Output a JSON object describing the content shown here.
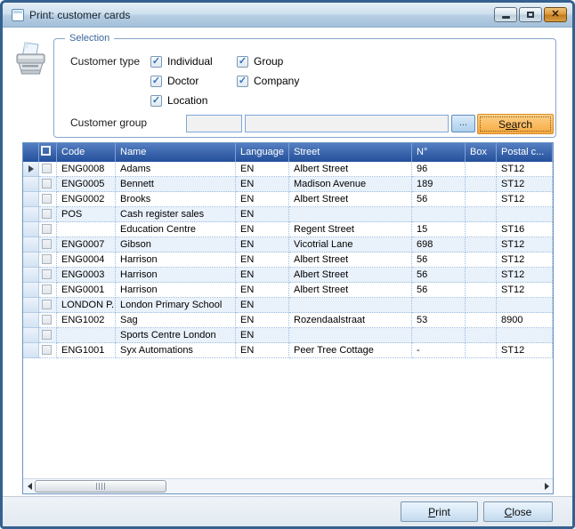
{
  "window": {
    "title": "Print: customer cards",
    "close_glyph": "✕"
  },
  "selection": {
    "group_label": "Selection",
    "customer_type_label": "Customer type",
    "customer_types": [
      {
        "label": "Individual",
        "checked": true
      },
      {
        "label": "Group",
        "checked": true
      },
      {
        "label": "Doctor",
        "checked": true
      },
      {
        "label": "Company",
        "checked": true
      },
      {
        "label": "Location",
        "checked": true
      }
    ],
    "customer_group_label": "Customer group",
    "group_code_value": "",
    "group_name_value": "",
    "browse_label": "...",
    "search_label": {
      "pre": "S",
      "key": "ea",
      "post": "rch"
    }
  },
  "grid": {
    "columns": [
      "Code",
      "Name",
      "Language",
      "Street",
      "N°",
      "Box",
      "Postal c..."
    ],
    "fields": [
      "code",
      "name",
      "language",
      "street",
      "no",
      "box",
      "postal"
    ],
    "rows": [
      {
        "code": "ENG0008",
        "name": "Adams",
        "language": "EN",
        "street": "Albert Street",
        "no": "96",
        "box": "",
        "postal": "ST12",
        "current": true,
        "checked": false
      },
      {
        "code": "ENG0005",
        "name": "Bennett",
        "language": "EN",
        "street": "Madison Avenue",
        "no": "189",
        "box": "",
        "postal": "ST12",
        "current": false,
        "checked": false
      },
      {
        "code": "ENG0002",
        "name": "Brooks",
        "language": "EN",
        "street": "Albert Street",
        "no": "56",
        "box": "",
        "postal": "ST12",
        "current": false,
        "checked": false
      },
      {
        "code": "POS",
        "name": "Cash register sales",
        "language": "EN",
        "street": "",
        "no": "",
        "box": "",
        "postal": "",
        "current": false,
        "checked": false
      },
      {
        "code": "",
        "name": "Education Centre",
        "language": "EN",
        "street": "Regent Street",
        "no": "15",
        "box": "",
        "postal": "ST16",
        "current": false,
        "checked": false
      },
      {
        "code": "ENG0007",
        "name": "Gibson",
        "language": "EN",
        "street": "Vicotrial Lane",
        "no": "698",
        "box": "",
        "postal": "ST12",
        "current": false,
        "checked": false
      },
      {
        "code": "ENG0004",
        "name": "Harrison",
        "language": "EN",
        "street": "Albert Street",
        "no": "56",
        "box": "",
        "postal": "ST12",
        "current": false,
        "checked": false
      },
      {
        "code": "ENG0003",
        "name": "Harrison",
        "language": "EN",
        "street": "Albert Street",
        "no": "56",
        "box": "",
        "postal": "ST12",
        "current": false,
        "checked": false
      },
      {
        "code": "ENG0001",
        "name": "Harrison",
        "language": "EN",
        "street": "Albert Street",
        "no": "56",
        "box": "",
        "postal": "ST12",
        "current": false,
        "checked": false
      },
      {
        "code": "LONDON P...",
        "name": "London Primary School",
        "language": "EN",
        "street": "",
        "no": "",
        "box": "",
        "postal": "",
        "current": false,
        "checked": false
      },
      {
        "code": "ENG1002",
        "name": "Sag",
        "language": "EN",
        "street": "Rozendaalstraat",
        "no": "53",
        "box": "",
        "postal": "8900",
        "current": false,
        "checked": false
      },
      {
        "code": "",
        "name": "Sports Centre London",
        "language": "EN",
        "street": "",
        "no": "",
        "box": "",
        "postal": "",
        "current": false,
        "checked": false
      },
      {
        "code": "ENG1001",
        "name": "Syx Automations",
        "language": "EN",
        "street": "Peer Tree Cottage",
        "no": "-",
        "box": "",
        "postal": "ST12",
        "current": false,
        "checked": false
      }
    ]
  },
  "footer": {
    "print_label": {
      "pre": "",
      "key": "P",
      "post": "rint"
    },
    "close_label": {
      "pre": "",
      "key": "C",
      "post": "lose"
    }
  },
  "colors": {
    "accent_orange": "#f5aa44",
    "header_blue": "#2a5191",
    "row_alt": "#e9f1fb",
    "window_border": "#35618f"
  }
}
